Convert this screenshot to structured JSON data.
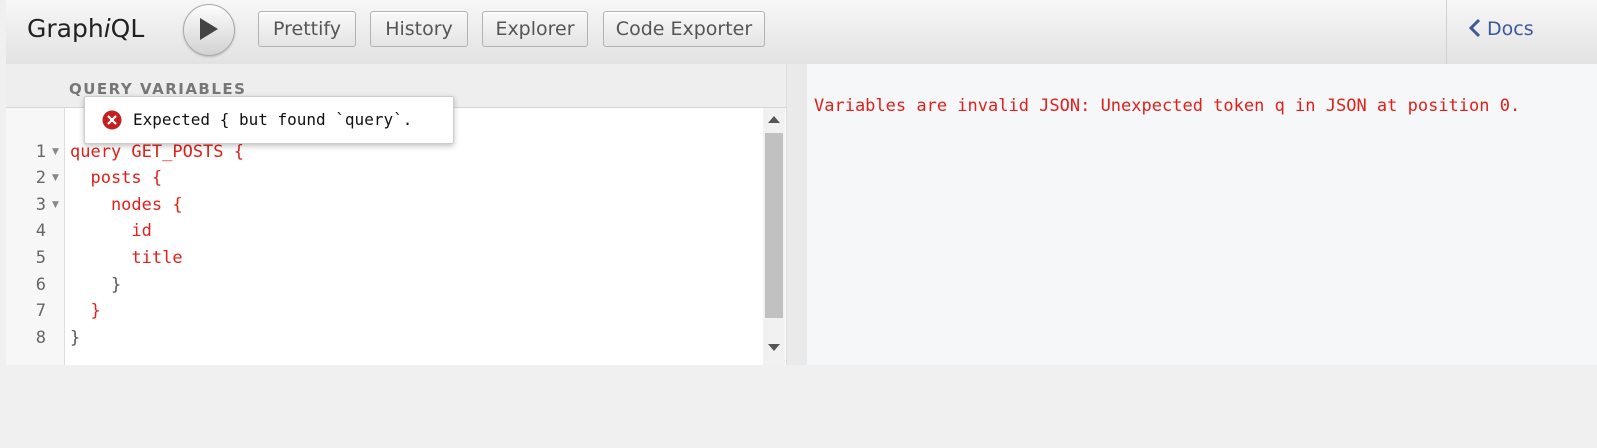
{
  "toolbar": {
    "logo_prefix": "Graph",
    "logo_italic": "i",
    "logo_suffix": "QL",
    "prettify_label": "Prettify",
    "history_label": "History",
    "explorer_label": "Explorer",
    "code_exporter_label": "Code Exporter",
    "docs_label": "Docs",
    "run_icon": "play-icon",
    "docs_icon": "chevron-left-icon"
  },
  "variables": {
    "title": "QUERY VARIABLES",
    "lines": [
      {
        "num": "1",
        "text": "query GET_POSTS {"
      },
      {
        "num": "2",
        "text": "  posts {"
      },
      {
        "num": "3",
        "text": "    nodes {"
      },
      {
        "num": "4",
        "text": "      id"
      },
      {
        "num": "5",
        "text": "      title"
      },
      {
        "num": "6",
        "text": "    }"
      },
      {
        "num": "7",
        "text": "  }"
      },
      {
        "num": "8",
        "text": "}"
      }
    ]
  },
  "tooltip": {
    "icon": "error-icon",
    "message": "Expected { but found `query`."
  },
  "result": {
    "error_text": "Variables are invalid JSON: Unexpected token q in JSON at position 0."
  },
  "colors": {
    "error_red": "#e0201b",
    "docs_blue": "#3b5998"
  }
}
